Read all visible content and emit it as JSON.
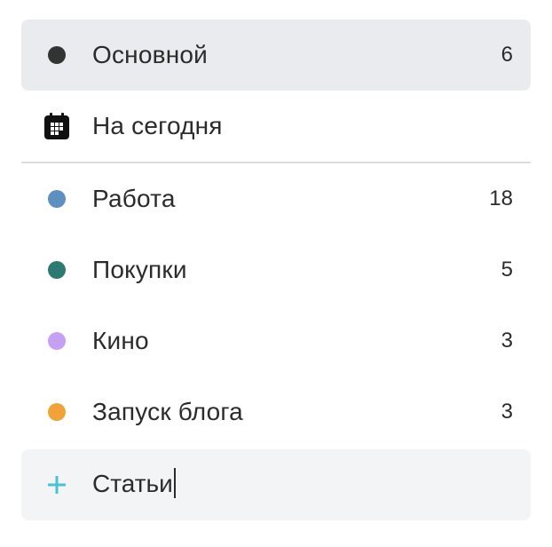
{
  "lists": {
    "main": {
      "label": "Основной",
      "count": "6",
      "color": "#333333",
      "icon": "filled-circle-icon"
    },
    "today": {
      "label": "На сегодня",
      "icon": "calendar-icon"
    },
    "items": [
      {
        "label": "Работа",
        "count": "18",
        "color": "#5b90bf"
      },
      {
        "label": "Покупки",
        "count": "5",
        "color": "#2e7a72"
      },
      {
        "label": "Кино",
        "count": "3",
        "color": "#c7a0f2"
      },
      {
        "label": "Запуск блога",
        "count": "3",
        "color": "#f0a23b"
      }
    ]
  },
  "new_list": {
    "value": "Статьи",
    "icon": "plus-icon",
    "accent": "#4cc0d6"
  }
}
